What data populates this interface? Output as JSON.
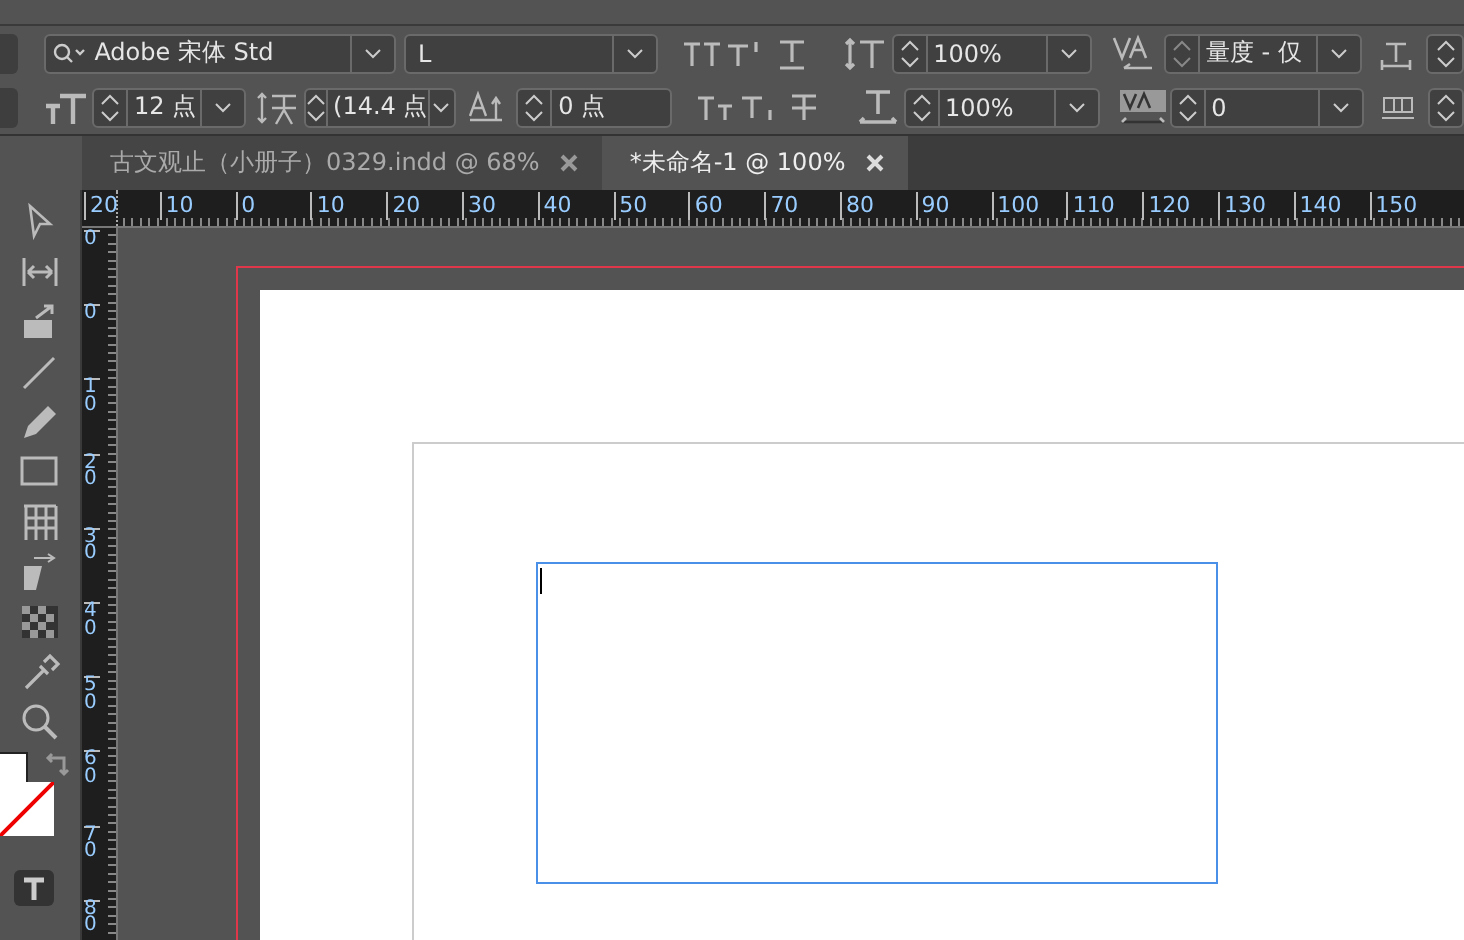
{
  "control_panel": {
    "font_family": "Adobe 宋体 Std",
    "font_style": "L",
    "font_size": "12 点",
    "leading": "(14.4 点",
    "baseline_shift": "0 点",
    "vertical_scale": "100%",
    "horizontal_scale": "100%",
    "kerning": "量度 - 仅",
    "tracking": "0"
  },
  "tabs": [
    {
      "label": "古文观止（小册子）0329.indd @ 68%",
      "selected": false
    },
    {
      "label": "*未命名-1 @ 100%",
      "selected": true
    }
  ],
  "horizontal_ruler": {
    "labels": [
      "20",
      "10",
      "0",
      "10",
      "20",
      "30",
      "40",
      "50",
      "60",
      "70",
      "80",
      "90",
      "100",
      "110",
      "120",
      "130",
      "140",
      "150"
    ]
  },
  "vertical_ruler": {
    "labels": [
      "0",
      "0",
      "10",
      "20",
      "30",
      "40",
      "50",
      "60",
      "70",
      "80"
    ]
  },
  "tools": [
    {
      "kind": "selection"
    },
    {
      "kind": "gap"
    },
    {
      "kind": "collector"
    },
    {
      "kind": "line"
    },
    {
      "kind": "pencil"
    },
    {
      "kind": "rectangle"
    },
    {
      "kind": "table"
    },
    {
      "kind": "transform"
    },
    {
      "kind": "gradient"
    },
    {
      "kind": "eyedropper"
    },
    {
      "kind": "zoom"
    }
  ]
}
